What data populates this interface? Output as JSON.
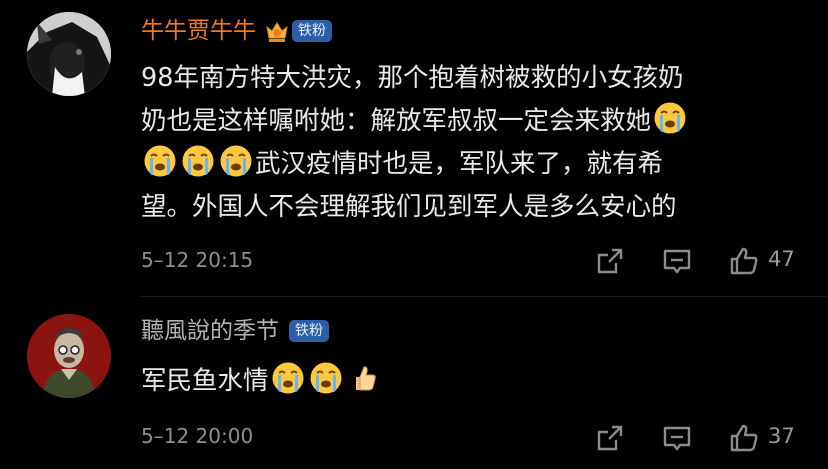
{
  "comments": [
    {
      "username": "牛牛贾牛牛",
      "badge_label": "铁粉",
      "has_crown": true,
      "text_lines": [
        [
          "98年南方特大洪灾，那个抱着树被救的小女孩奶"
        ],
        [
          "奶也是这样嘱咐她：解放军叔叔一定会来救她",
          "[crying-emoji]"
        ],
        [
          "[crying-emoji]",
          "[crying-emoji]",
          "[crying-emoji]",
          "武汉疫情时也是，军队来了，就有希"
        ],
        [
          "望。外国人不会理解我们见到军人是多么安心的"
        ]
      ],
      "line1": "98年南方特大洪灾，那个抱着树被救的小女孩奶",
      "line2": "奶也是这样嘱咐她：解放军叔叔一定会来救她",
      "line3": "武汉疫情时也是，军队来了，就有希",
      "line4": "望。外国人不会理解我们见到军人是多么安心的",
      "timestamp": "5–12 20:15",
      "like_count": "47"
    },
    {
      "username": "聽風說的季节",
      "badge_label": "铁粉",
      "has_crown": false,
      "line1": "军民鱼水情",
      "timestamp": "5–12 20:00",
      "like_count": "37"
    }
  ],
  "icons": {
    "share": "share-icon",
    "reply": "comment-icon",
    "like": "thumbs-up-icon",
    "crying_emoji": "crying-face-emoji",
    "thumbs_emoji": "thumbs-up-emoji",
    "crown": "crown-badge-icon"
  },
  "colors": {
    "background": "#000000",
    "username_highlight": "#f0761f",
    "username_normal": "#b4b4b4",
    "badge": "#2d5fa8",
    "meta_text": "#8f8f8f"
  }
}
